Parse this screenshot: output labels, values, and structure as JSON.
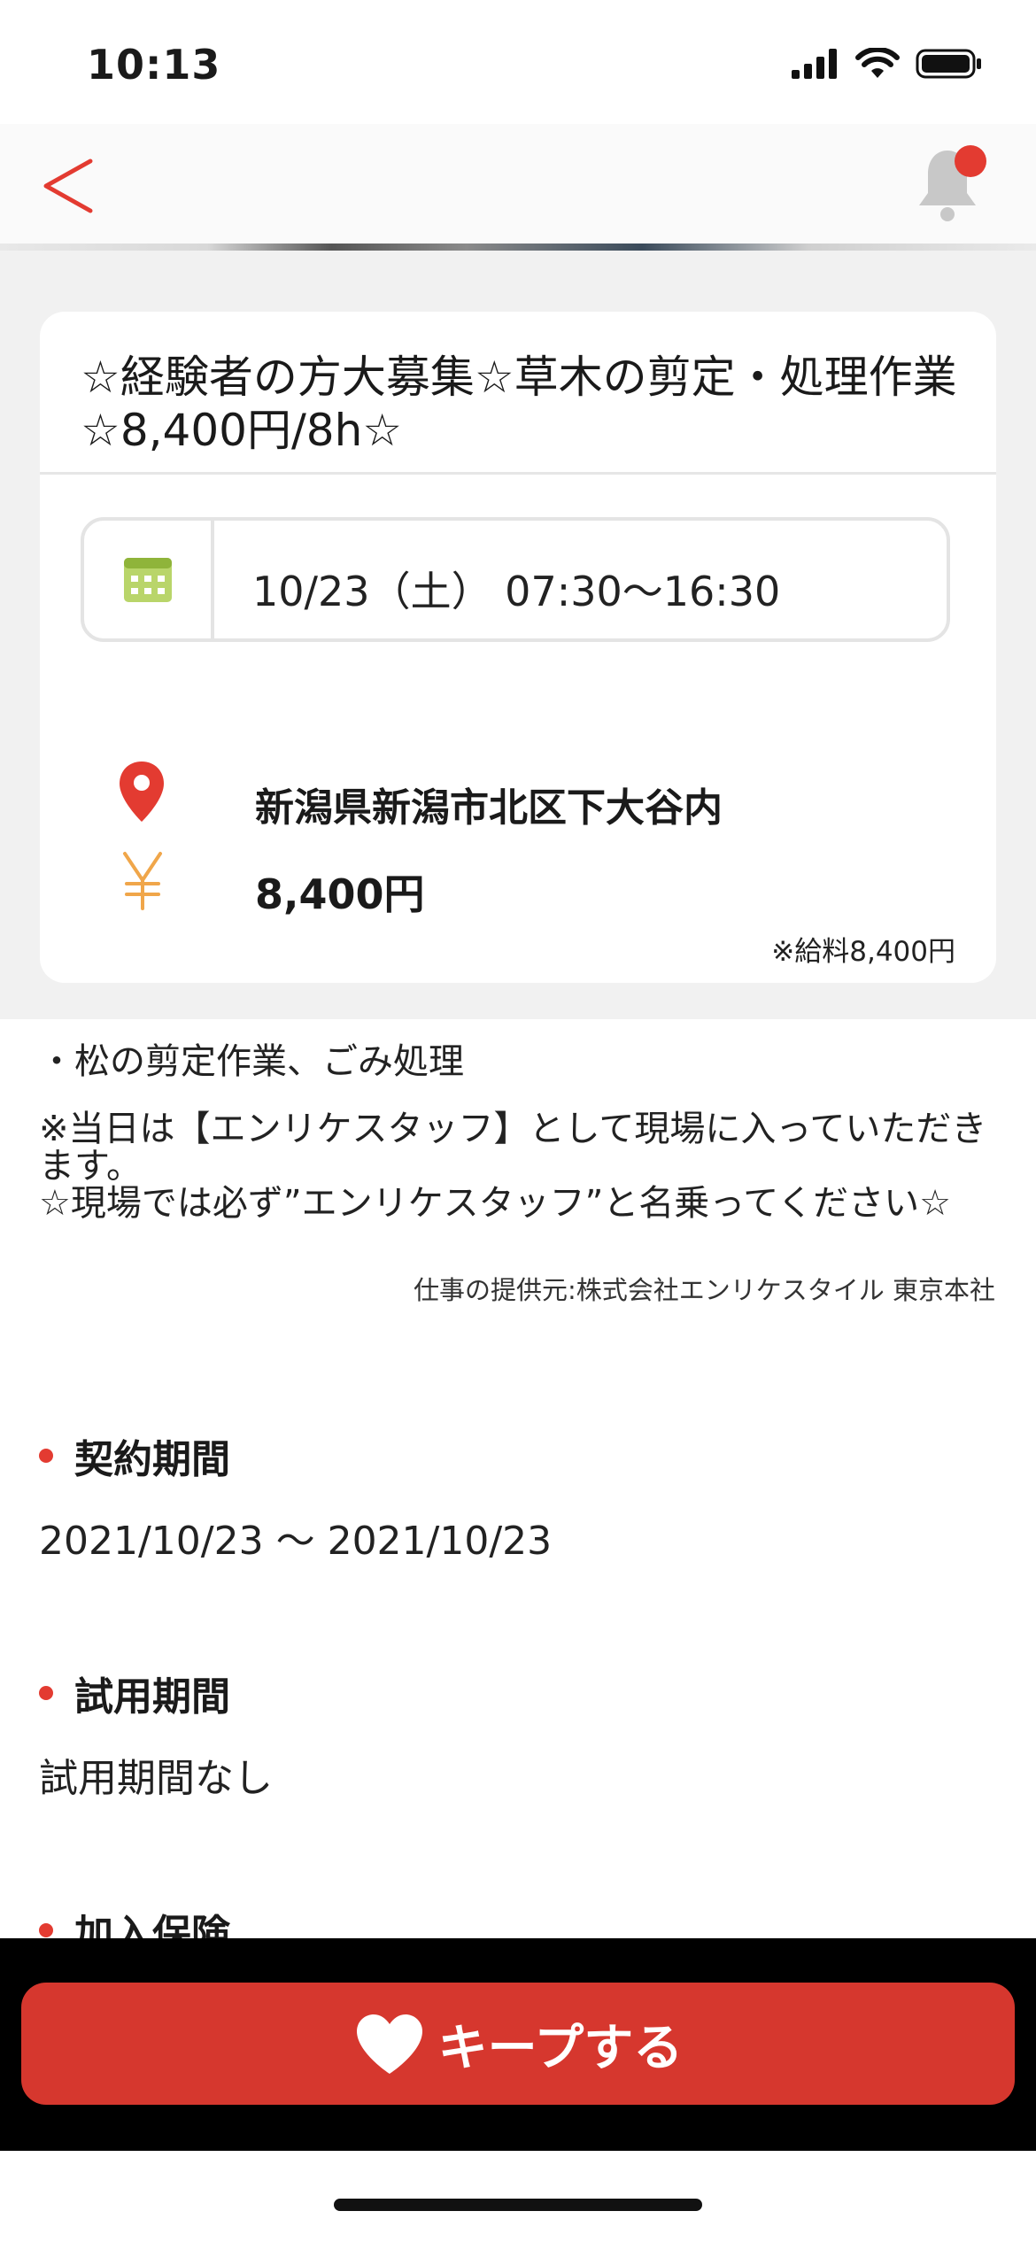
{
  "status_bar": {
    "time": "10:13",
    "icons": [
      "signal-icon",
      "wifi-icon",
      "battery-icon"
    ]
  },
  "nav": {
    "back_icon": "chevron-left-icon",
    "bell_icon": "bell-icon",
    "has_notification_badge": true,
    "accent_color": "#e33b31"
  },
  "job": {
    "title": "☆経験者の方大募集☆草木の剪定・処理作業☆8,400円/8h☆",
    "date_icon": "calendar-icon",
    "date": "10/23（土） 07:30〜16:30",
    "location_icon": "map-pin-icon",
    "location": "新潟県新潟市北区下大谷内",
    "wage_icon": "yen-icon",
    "wage": "8,400円",
    "wage_note": "※給料8,400円"
  },
  "description": {
    "line1": "・松の剪定作業、ごみ処理",
    "line2": "※当日は【エンリケスタッフ】として現場に入っていただきます。\n☆現場では必ず”エンリケスタッフ”と名乗ってください☆",
    "provider": "仕事の提供元:株式会社エンリケスタイル 東京本社"
  },
  "sections": {
    "contract_period_label": "契約期間",
    "contract_period_value": "2021/10/23 〜 2021/10/23",
    "trial_period_label": "試用期間",
    "trial_period_value": "試用期間なし",
    "insurance_label": "加入保険"
  },
  "keep_button": {
    "label": "キープする",
    "icon": "heart-icon",
    "color": "#d6372e"
  }
}
